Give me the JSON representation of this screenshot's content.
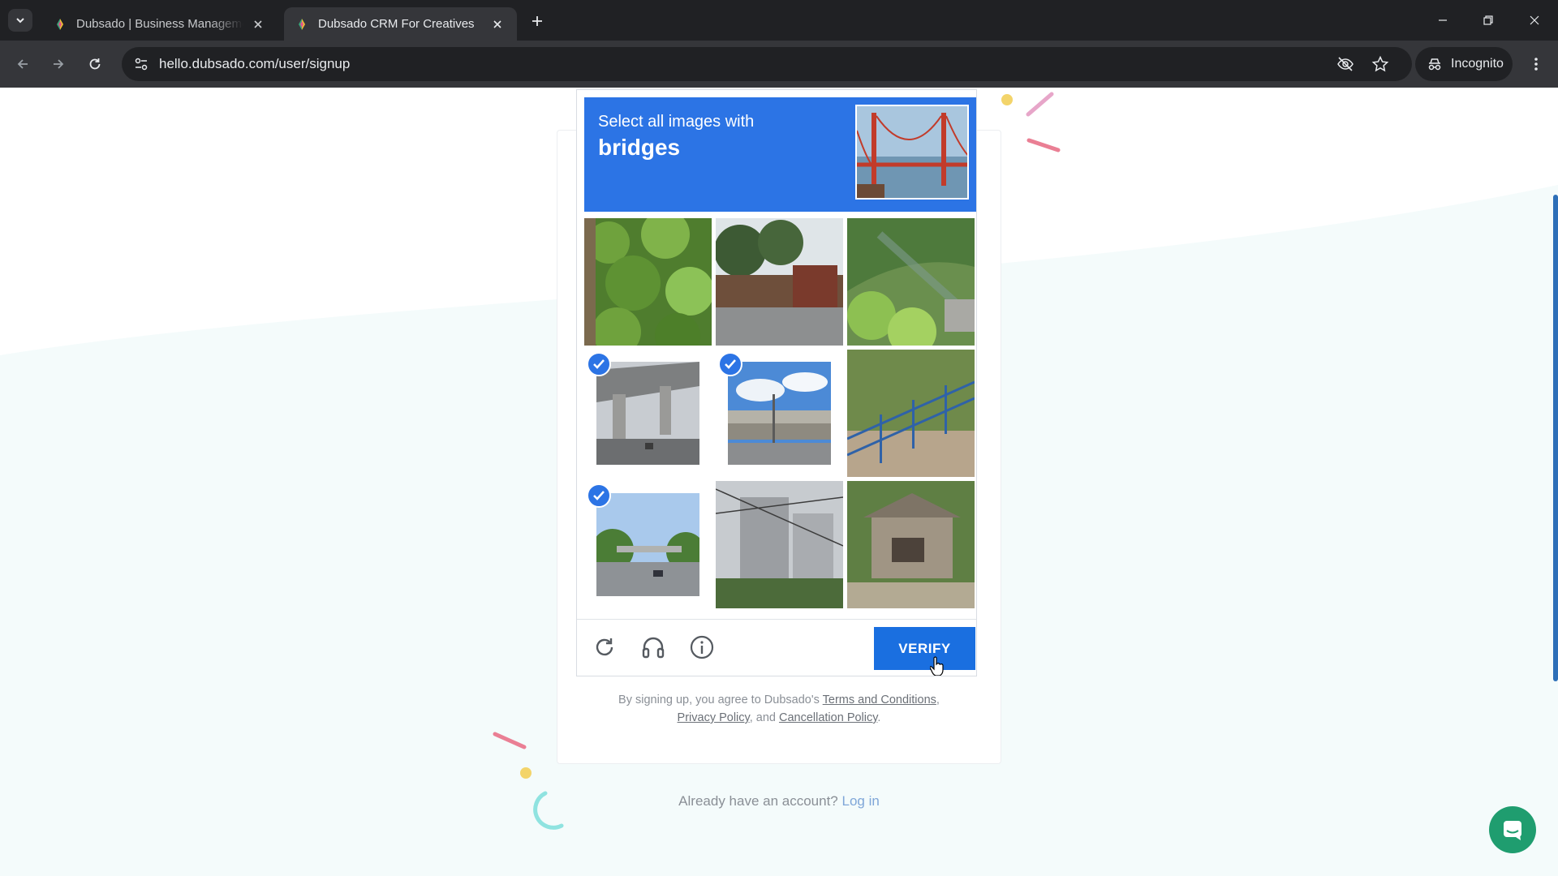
{
  "browser": {
    "tabs": [
      {
        "title": "Dubsado | Business Manageme",
        "active": false
      },
      {
        "title": "Dubsado CRM For Creatives",
        "active": true
      }
    ],
    "url": "hello.dubsado.com/user/signup",
    "profile_label": "Incognito"
  },
  "captcha": {
    "instruction_prefix": "Select all images with",
    "instruction_target": "bridges",
    "tiles": [
      {
        "label": "ivy wall and gate",
        "selected": false
      },
      {
        "label": "street with gate",
        "selected": false
      },
      {
        "label": "green hillside with fence",
        "selected": false
      },
      {
        "label": "highway overpass underside",
        "selected": true
      },
      {
        "label": "overpass and street lamp",
        "selected": true
      },
      {
        "label": "blue railing",
        "selected": false
      },
      {
        "label": "highway bridge",
        "selected": true
      },
      {
        "label": "buildings and power lines",
        "selected": false
      },
      {
        "label": "stone house",
        "selected": false
      }
    ],
    "verify_label": "VERIFY"
  },
  "legal": {
    "prefix": "By signing up, you agree to Dubsado's",
    "terms": "Terms and Conditions",
    "comma": ",",
    "privacy": "Privacy Policy",
    "and": ", and",
    "cancellation": "Cancellation Policy",
    "period": "."
  },
  "login": {
    "prompt": "Already have an account?",
    "link": "Log in"
  },
  "colors": {
    "captcha_blue": "#2c74e5",
    "verify_blue": "#1a6fe0",
    "chat_green": "#1f9d6f",
    "chrome_dark": "#202124"
  }
}
